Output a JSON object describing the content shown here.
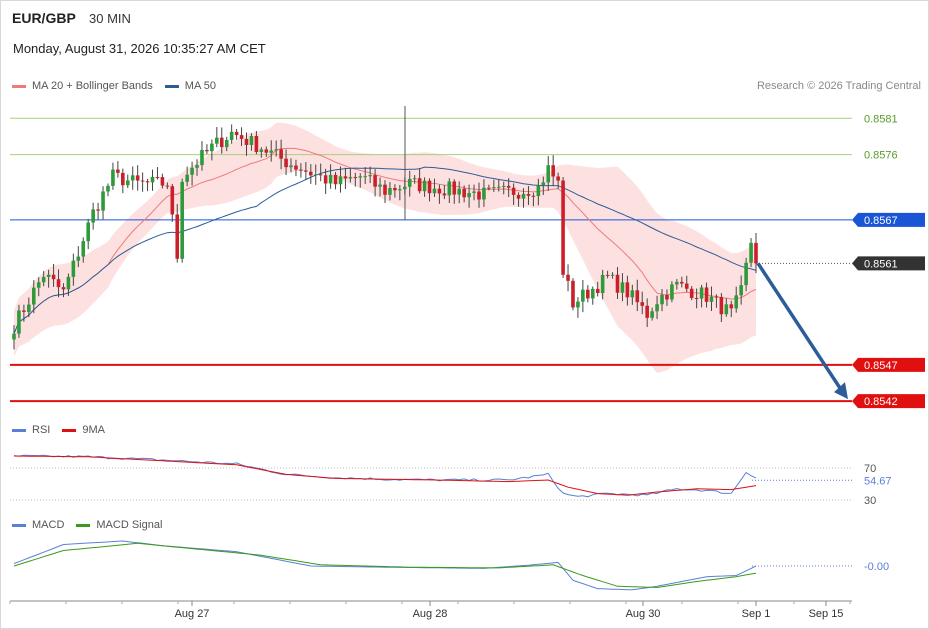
{
  "header": {
    "symbol": "EUR/GBP",
    "interval": "30 MIN",
    "datetime": "Monday, August 31, 2026 10:35:27 AM CET",
    "credit": "Research © 2026 Trading Central"
  },
  "legends": {
    "main": [
      {
        "name": "MA 20 + Bollinger Bands",
        "color": "#f07a7a"
      },
      {
        "name": "MA 50",
        "color": "#2d5d99"
      }
    ],
    "rsi": [
      {
        "name": "RSI",
        "color": "#5b7fd6"
      },
      {
        "name": "9MA",
        "color": "#dd1111"
      }
    ],
    "macd": [
      {
        "name": "MACD",
        "color": "#5b7fd6"
      },
      {
        "name": "MACD Signal",
        "color": "#3a9a1a"
      }
    ]
  },
  "colors": {
    "up": "#2e9a3a",
    "down": "#cc1f2a",
    "band_fill": "#fde1e1",
    "ma20": "#f07a7a",
    "ma50": "#2d5d99",
    "resistance": "#1a55d6",
    "support": "#e01010",
    "target": "#a8cf7e",
    "arrow": "#2d5d99",
    "last": "#333333"
  },
  "chart_data": [
    {
      "type": "candlestick",
      "name": "price",
      "y_range": [
        0.85405,
        0.85838
      ],
      "x_ticks": [
        "Aug 27",
        "Aug 28",
        "Aug 30",
        "Sep 1",
        "Sep 15"
      ],
      "levels": [
        {
          "label": "0.8581",
          "value": 0.8581,
          "role": "target"
        },
        {
          "label": "0.8576",
          "value": 0.8576,
          "role": "target"
        },
        {
          "label": "0.8567",
          "value": 0.8567,
          "role": "resistance"
        },
        {
          "label": "0.8561",
          "value": 0.8561,
          "role": "last"
        },
        {
          "label": "0.8547",
          "value": 0.8547,
          "role": "support"
        },
        {
          "label": "0.8542",
          "value": 0.8542,
          "role": "support"
        }
      ],
      "forecast_arrow": {
        "from": 0.8561,
        "to": 0.8542
      },
      "anchors": [
        {
          "i": 0,
          "v": 0.85524
        },
        {
          "i": 6,
          "v": 0.85595
        },
        {
          "i": 10,
          "v": 0.8557
        },
        {
          "i": 16,
          "v": 0.8568
        },
        {
          "i": 20,
          "v": 0.8573
        },
        {
          "i": 25,
          "v": 0.8572
        },
        {
          "i": 31,
          "v": 0.8572
        },
        {
          "i": 33,
          "v": 0.8562
        },
        {
          "i": 34,
          "v": 0.8573
        },
        {
          "i": 40,
          "v": 0.8577
        },
        {
          "i": 44,
          "v": 0.8579
        },
        {
          "i": 50,
          "v": 0.8577
        },
        {
          "i": 55,
          "v": 0.8575
        },
        {
          "i": 65,
          "v": 0.8572
        },
        {
          "i": 70,
          "v": 0.8573
        },
        {
          "i": 75,
          "v": 0.8571
        },
        {
          "i": 80,
          "v": 0.8572
        },
        {
          "i": 90,
          "v": 0.8571
        },
        {
          "i": 95,
          "v": 0.85705
        },
        {
          "i": 102,
          "v": 0.8571
        },
        {
          "i": 106,
          "v": 0.85715
        },
        {
          "i": 108,
          "v": 0.8574
        },
        {
          "i": 110,
          "v": 0.8572
        },
        {
          "i": 111,
          "v": 0.856
        },
        {
          "i": 113,
          "v": 0.85555
        },
        {
          "i": 120,
          "v": 0.8559
        },
        {
          "i": 124,
          "v": 0.8557
        },
        {
          "i": 128,
          "v": 0.8554
        },
        {
          "i": 130,
          "v": 0.8556
        },
        {
          "i": 134,
          "v": 0.8558
        },
        {
          "i": 140,
          "v": 0.85565
        },
        {
          "i": 145,
          "v": 0.8554
        },
        {
          "i": 147,
          "v": 0.8557
        },
        {
          "i": 149,
          "v": 0.8564
        },
        {
          "i": 150,
          "v": 0.8561
        }
      ],
      "bollinger_width": {
        "base": 0.00032,
        "widen_from": 110,
        "widen_peak": 0.0011
      }
    },
    {
      "type": "line",
      "name": "RSI",
      "y_range": [
        15,
        90
      ],
      "ticks": [
        {
          "label": "70",
          "value": 70
        },
        {
          "label": "54.67",
          "value": 54.67
        },
        {
          "label": "30",
          "value": 30
        }
      ],
      "series": [
        {
          "name": "RSI",
          "anchors": [
            [
              0,
              85
            ],
            [
              15,
              84
            ],
            [
              30,
              80
            ],
            [
              45,
              75
            ],
            [
              55,
              62
            ],
            [
              65,
              58
            ],
            [
              75,
              56
            ],
            [
              85,
              55
            ],
            [
              100,
              55
            ],
            [
              108,
              62
            ],
            [
              111,
              38
            ],
            [
              114,
              34
            ],
            [
              120,
              38
            ],
            [
              128,
              36
            ],
            [
              134,
              44
            ],
            [
              140,
              42
            ],
            [
              145,
              38
            ],
            [
              148,
              65
            ],
            [
              150,
              58
            ]
          ]
        },
        {
          "name": "9MA",
          "anchors": [
            [
              0,
              85
            ],
            [
              15,
              84
            ],
            [
              30,
              79
            ],
            [
              45,
              74
            ],
            [
              55,
              62
            ],
            [
              65,
              57
            ],
            [
              75,
              56
            ],
            [
              85,
              55
            ],
            [
              100,
              53
            ],
            [
              108,
              55
            ],
            [
              112,
              46
            ],
            [
              118,
              38
            ],
            [
              124,
              36
            ],
            [
              130,
              40
            ],
            [
              138,
              44
            ],
            [
              145,
              43
            ],
            [
              150,
              48
            ]
          ]
        }
      ]
    },
    {
      "type": "line",
      "name": "MACD",
      "y_range": [
        -1.3,
        1.3
      ],
      "ticks": [
        {
          "label": "-0.00",
          "value": 0
        }
      ],
      "series": [
        {
          "name": "MACD",
          "anchors": [
            [
              0,
              0.1
            ],
            [
              10,
              0.9
            ],
            [
              22,
              1.05
            ],
            [
              30,
              0.85
            ],
            [
              45,
              0.6
            ],
            [
              60,
              0.0
            ],
            [
              75,
              -0.05
            ],
            [
              95,
              -0.1
            ],
            [
              105,
              0.05
            ],
            [
              110,
              0.15
            ],
            [
              113,
              -0.6
            ],
            [
              118,
              -0.95
            ],
            [
              125,
              -1.0
            ],
            [
              130,
              -0.85
            ],
            [
              140,
              -0.45
            ],
            [
              146,
              -0.4
            ],
            [
              150,
              0.0
            ]
          ]
        },
        {
          "name": "MACD Signal",
          "anchors": [
            [
              0,
              0.0
            ],
            [
              10,
              0.65
            ],
            [
              25,
              0.95
            ],
            [
              35,
              0.75
            ],
            [
              50,
              0.45
            ],
            [
              62,
              0.05
            ],
            [
              80,
              -0.05
            ],
            [
              98,
              -0.08
            ],
            [
              109,
              0.05
            ],
            [
              115,
              -0.4
            ],
            [
              122,
              -0.85
            ],
            [
              130,
              -0.9
            ],
            [
              138,
              -0.65
            ],
            [
              146,
              -0.45
            ],
            [
              150,
              -0.3
            ]
          ]
        }
      ]
    }
  ]
}
